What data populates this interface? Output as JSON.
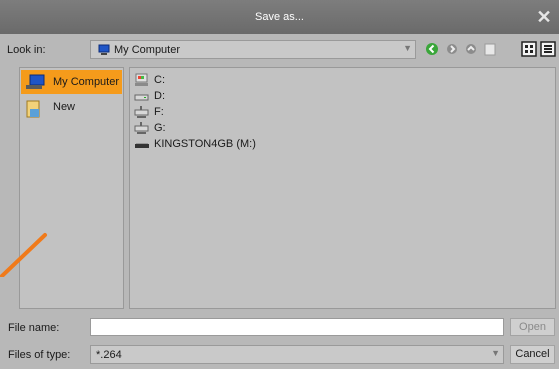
{
  "window": {
    "title": "Save as..."
  },
  "toolbar": {
    "look_in_label": "Look in:",
    "look_in_value": "My Computer",
    "buttons": [
      "back-icon",
      "forward-icon",
      "up-folder-icon",
      "new-folder-icon",
      "list-view-icon",
      "detail-view-icon"
    ]
  },
  "sidebar": {
    "items": [
      {
        "label": "My Computer",
        "icon": "computer-icon",
        "selected": true
      },
      {
        "label": "New",
        "icon": "folder-icon",
        "selected": false
      }
    ]
  },
  "files": {
    "items": [
      {
        "label": "C:",
        "icon": "system-drive-icon"
      },
      {
        "label": "D:",
        "icon": "drive-icon"
      },
      {
        "label": "F:",
        "icon": "network-drive-icon"
      },
      {
        "label": "G:",
        "icon": "network-drive-icon"
      },
      {
        "label": "KINGSTON4GB (M:)",
        "icon": "usb-drive-icon"
      }
    ]
  },
  "footer": {
    "file_name_label": "File name:",
    "file_name_value": "",
    "open_label": "Open",
    "file_type_label": "Files of type:",
    "file_type_value": "*.264",
    "cancel_label": "Cancel"
  },
  "colors": {
    "titlebar": "#737373",
    "selection": "#f59b1b",
    "panel": "#c2c2c2",
    "arrow": "#f07a1a"
  }
}
